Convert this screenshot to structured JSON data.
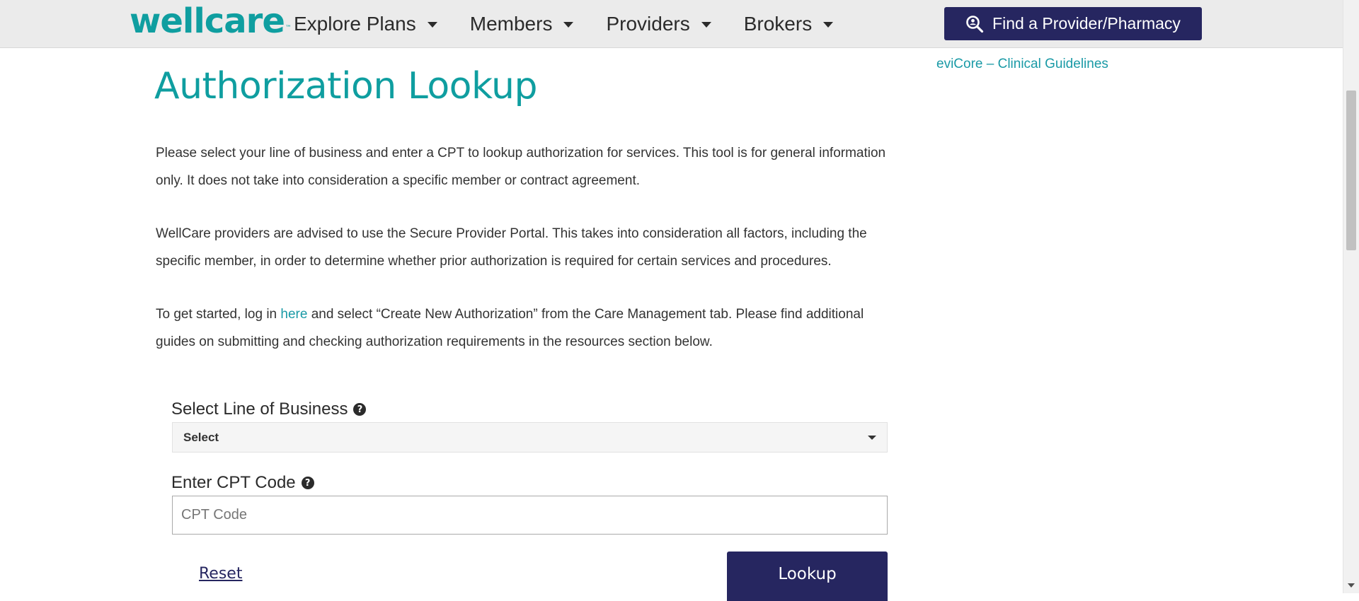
{
  "header": {
    "logo_text": "wellcare",
    "logo_tm": "™",
    "nav": [
      {
        "label": "Explore Plans"
      },
      {
        "label": "Members"
      },
      {
        "label": "Providers"
      },
      {
        "label": "Brokers"
      }
    ],
    "find_button_label": "Find a Provider/Pharmacy"
  },
  "sidebar": {
    "link_label": "eviCore – Clinical Guidelines"
  },
  "main": {
    "title": "Authorization Lookup",
    "para1": "Please select your line of business and enter a CPT to lookup authorization for services. This tool is for general information only. It does not take into consideration a specific member or contract agreement.",
    "para2": "WellCare providers are advised to use the Secure Provider Portal. This takes into consideration all factors, including the specific member, in order to determine whether prior authorization is required for certain services and procedures.",
    "para3_before": "To get started, log in ",
    "para3_link": "here",
    "para3_after": " and select “Create New Authorization” from the Care Management tab. Please find additional guides on submitting and checking authorization requirements in the resources section below."
  },
  "form": {
    "lob_label": "Select Line of Business",
    "lob_selected": "Select",
    "cpt_label": "Enter CPT Code",
    "cpt_placeholder": "CPT Code",
    "cpt_value": "",
    "help_glyph": "?",
    "reset_label": "Reset",
    "lookup_label": "Lookup"
  },
  "colors": {
    "brand_teal": "#0f9ea0",
    "brand_navy": "#262660",
    "link_teal": "#1a9aa6",
    "header_bg": "#ebebeb"
  },
  "icons": {
    "find_button_icon": "search-person-icon",
    "help_icon": "question-circle-icon",
    "dropdown_icon": "caret-down-icon"
  }
}
